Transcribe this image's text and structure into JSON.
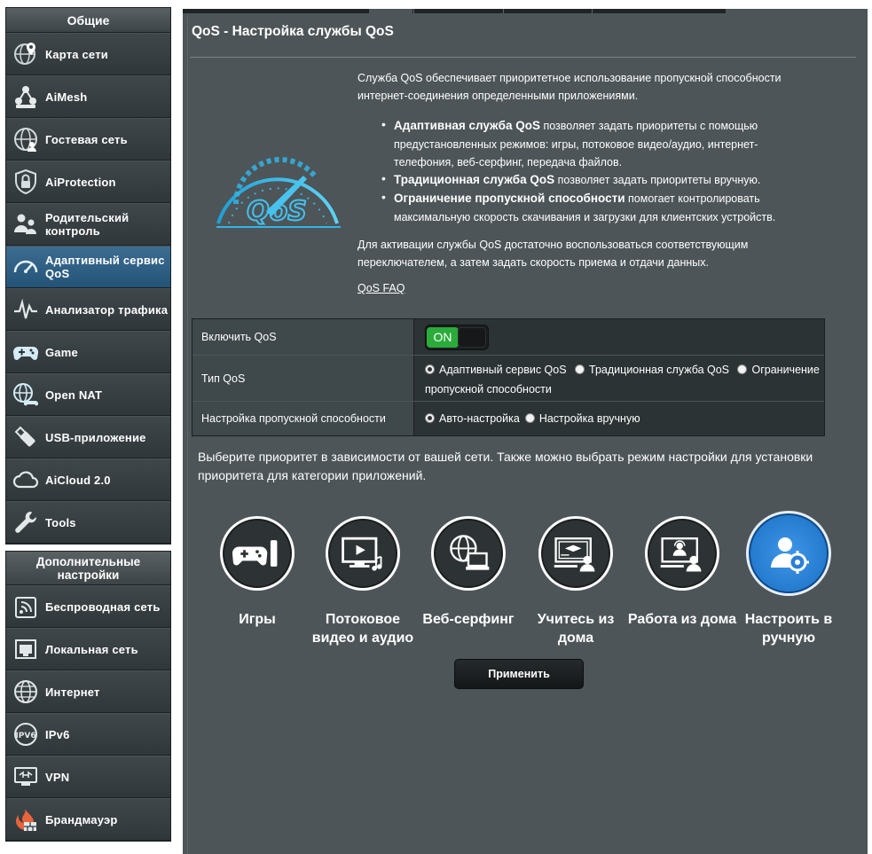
{
  "sidebar": {
    "general_title": "Общие",
    "items": [
      {
        "label": "Карта сети",
        "icon": "network-map-icon"
      },
      {
        "label": "AiMesh",
        "icon": "aimesh-icon"
      },
      {
        "label": "Гостевая сеть",
        "icon": "guest-network-icon"
      },
      {
        "label": "AiProtection",
        "icon": "shield-lock-icon"
      },
      {
        "label": "Родительский контроль",
        "icon": "parental-control-icon"
      },
      {
        "label": "Адаптивный сервис QoS",
        "icon": "qos-gauge-icon",
        "active": true
      },
      {
        "label": "Анализатор трафика",
        "icon": "traffic-analyzer-icon"
      },
      {
        "label": "Game",
        "icon": "gamepad-icon"
      },
      {
        "label": "Open NAT",
        "icon": "open-nat-icon"
      },
      {
        "label": "USB-приложение",
        "icon": "usb-icon"
      },
      {
        "label": "AiCloud 2.0",
        "icon": "cloud-icon"
      },
      {
        "label": "Tools",
        "icon": "wrench-icon"
      }
    ],
    "advanced_title": "Дополнительные настройки",
    "advanced_items": [
      {
        "label": "Беспроводная сеть",
        "icon": "wireless-icon"
      },
      {
        "label": "Локальная сеть",
        "icon": "lan-icon"
      },
      {
        "label": "Интернет",
        "icon": "globe-icon"
      },
      {
        "label": "IPv6",
        "icon": "ipv6-icon"
      },
      {
        "label": "VPN",
        "icon": "vpn-icon"
      },
      {
        "label": "Брандмауэр",
        "icon": "firewall-icon"
      }
    ]
  },
  "main": {
    "title": "QoS - Настройка службы QoS",
    "description": "Служба QoS обеспечивает приоритетное использование пропускной способности интернет-соединения определенными приложениями.",
    "bullets": [
      {
        "bold": "Адаптивная служба QoS",
        "text": " позволяет задать приоритеты с помощью предустановленных режимов: игры, потоковое видео/аудио, интернет-телефония, веб-серфинг, передача файлов."
      },
      {
        "bold": "Традиционная служба QoS",
        "text": " позволяет задать приоритеты вручную."
      },
      {
        "bold": "Ограничение пропускной способности",
        "text": " помогает контролировать максимальную скорость скачивания и загрузки для клиентских устройств."
      }
    ],
    "activation_text": "Для активации службы QoS достаточно воспользоваться соответствующим переключателем, а затем задать скорость приема и отдачи данных.",
    "faq_link": "QoS FAQ",
    "logo_text": "QoS"
  },
  "settings": {
    "enable_label": "Включить QoS",
    "enable_state": "ON",
    "type_label": "Тип QoS",
    "type_options": [
      "Адаптивный сервис QoS",
      "Традиционная служба QoS",
      "Ограничение пропускной способности"
    ],
    "type_selected": 0,
    "bandwidth_label": "Настройка пропускной способности",
    "bandwidth_options": [
      "Авто-настройка",
      "Настройка вручную"
    ],
    "bandwidth_selected": 0
  },
  "priority_text": "Выберите приоритет в зависимости от вашей сети. Также можно выбрать режим настройки для установки приоритета для категории приложений.",
  "modes": [
    {
      "label": "Игры",
      "icon": "gaming-icon"
    },
    {
      "label": "Потоковое видео и аудио",
      "icon": "streaming-icon"
    },
    {
      "label": "Веб-серфинг",
      "icon": "web-surfing-icon"
    },
    {
      "label": "Учитесь из дома",
      "icon": "learn-from-home-icon"
    },
    {
      "label": "Работа из дома",
      "icon": "work-from-home-icon"
    },
    {
      "label": "Настроить в ручную",
      "icon": "customize-user-gear-icon",
      "selected": true
    }
  ],
  "apply_label": "Применить"
}
